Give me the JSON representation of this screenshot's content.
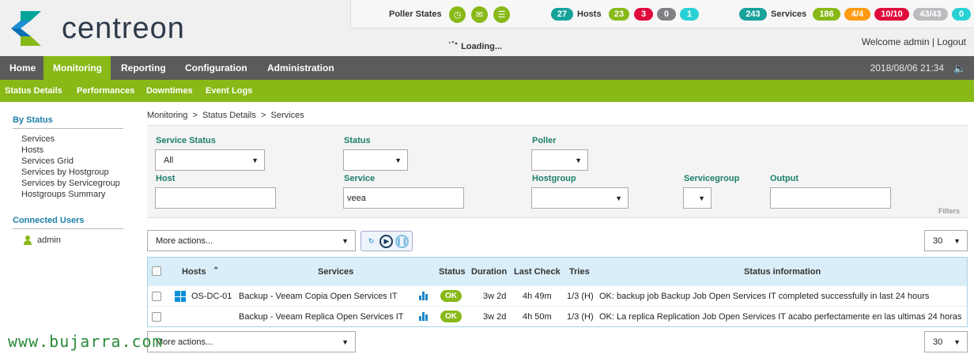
{
  "logo": {
    "text": "centreon",
    "colors": {
      "teal": "#00a499",
      "blue": "#0a6fb5",
      "green": "#88b917"
    }
  },
  "top_status": {
    "poller_label": "Poller States",
    "poller_icons": [
      "clock-icon",
      "mail-icon",
      "database-icon"
    ],
    "hosts_label": "Hosts",
    "hosts_total": "27",
    "hosts_counts": [
      {
        "value": "23",
        "color": "#88b917"
      },
      {
        "value": "3",
        "color": "#e00b3d"
      },
      {
        "value": "0",
        "color": "#818185"
      },
      {
        "value": "1",
        "color": "#2ad1d4"
      }
    ],
    "services_label": "Services",
    "services_total": "243",
    "services_counts": [
      {
        "value": "186",
        "color": "#88b917"
      },
      {
        "value": "4/4",
        "color": "#ff9a13"
      },
      {
        "value": "10/10",
        "color": "#e00b3d"
      },
      {
        "value": "43/43",
        "color": "#bcbdc0"
      },
      {
        "value": "0",
        "color": "#2ad1d4"
      }
    ],
    "total_color": "#17a29b"
  },
  "loading_text": "Loading...",
  "welcome": "Welcome admin | Logout",
  "main_nav": {
    "items": [
      "Home",
      "Monitoring",
      "Reporting",
      "Configuration",
      "Administration"
    ],
    "active": "Monitoring",
    "datetime": "2018/08/06 21:34"
  },
  "sub_nav": [
    "Status Details",
    "Performances",
    "Downtimes",
    "Event Logs"
  ],
  "sidebar": {
    "by_status_title": "By Status",
    "by_status_items": [
      "Services",
      "Hosts",
      "Services Grid",
      "Services by Hostgroup",
      "Services by Servicegroup",
      "Hostgroups Summary"
    ],
    "connected_title": "Connected Users",
    "users": [
      "admin"
    ]
  },
  "breadcrumb": "Monitoring  >  Status Details  >  Services",
  "filters": {
    "service_status_label": "Service Status",
    "service_status_value": "All",
    "status_label": "Status",
    "status_value": "",
    "poller_label": "Poller",
    "poller_value": "",
    "host_label": "Host",
    "host_value": "",
    "service_label": "Service",
    "service_value": "veea",
    "hostgroup_label": "Hostgroup",
    "hostgroup_value": "",
    "servicegroup_label": "Servicegroup",
    "servicegroup_value": "",
    "output_label": "Output",
    "output_value": "",
    "caption": "Filters"
  },
  "toolbar": {
    "more_actions": "More actions...",
    "per_page": "30",
    "buttons": [
      "refresh-icon",
      "play-icon",
      "pause-icon"
    ]
  },
  "table": {
    "columns": [
      "Hosts",
      "Services",
      "Status",
      "Duration",
      "Last Check",
      "Tries",
      "Status information"
    ],
    "rows": [
      {
        "host": "OS-DC-01",
        "service": "Backup - Veeam Copia Open Services IT",
        "status": "OK",
        "duration": "3w 2d",
        "last_check": "4h 49m",
        "tries": "1/3 (H)",
        "info": "OK: backup job Backup Job Open Services IT completed successfully in last 24 hours"
      },
      {
        "host": "",
        "service": "Backup - Veeam Replica Open Services IT",
        "status": "OK",
        "duration": "3w 2d",
        "last_check": "4h 50m",
        "tries": "1/3 (H)",
        "info": "OK: La replica Replication Job Open Services IT acabo perfectamente en las ultimas 24 horas"
      }
    ]
  },
  "watermark": "www.bujarra.com"
}
